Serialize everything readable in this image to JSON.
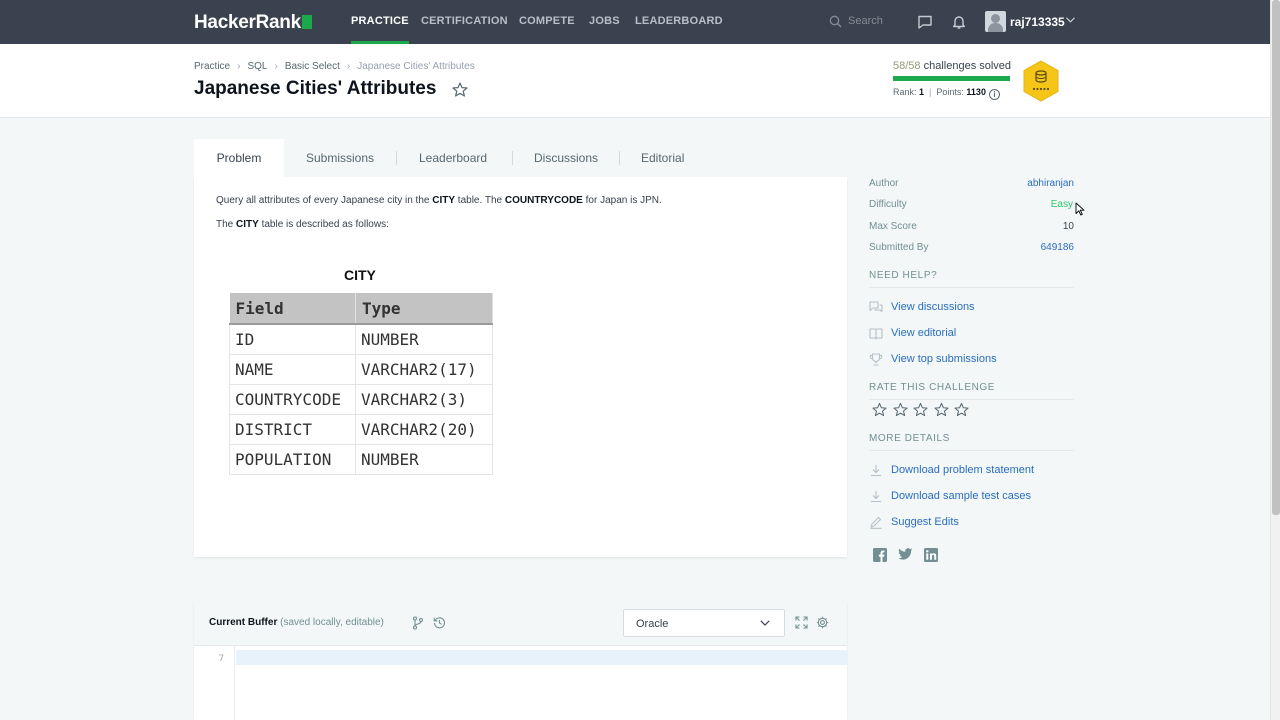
{
  "nav": {
    "logo": "HackerRank",
    "items": [
      "PRACTICE",
      "CERTIFICATION",
      "COMPETE",
      "JOBS",
      "LEADERBOARD"
    ],
    "active": "PRACTICE",
    "search_placeholder": "Search",
    "username": "raj713335"
  },
  "header": {
    "breadcrumbs": [
      "Practice",
      "SQL",
      "Basic Select",
      "Japanese Cities' Attributes"
    ],
    "title": "Japanese Cities' Attributes",
    "solved_count": "58/58",
    "solved_label": "challenges solved",
    "solved_progress": 1.0,
    "rank_label": "Rank:",
    "rank_value": "1",
    "points_label": "Points:",
    "points_value": "1130"
  },
  "tabs": [
    "Problem",
    "Submissions",
    "Leaderboard",
    "Discussions",
    "Editorial"
  ],
  "problem": {
    "p1_a": "Query all attributes of every Japanese city in the ",
    "p1_b": "CITY",
    "p1_c": " table. The ",
    "p1_d": "COUNTRYCODE",
    "p1_e": " for Japan is ",
    "p1_f": "JPN",
    "p1_g": ".",
    "p2_a": "The ",
    "p2_b": "CITY",
    "p2_c": " table is described as follows:",
    "table_caption": "CITY",
    "table_headers": [
      "Field",
      "Type"
    ],
    "table_rows": [
      [
        "ID",
        "NUMBER"
      ],
      [
        "NAME",
        "VARCHAR2(17)"
      ],
      [
        "COUNTRYCODE",
        "VARCHAR2(3)"
      ],
      [
        "DISTRICT",
        "VARCHAR2(20)"
      ],
      [
        "POPULATION",
        "NUMBER"
      ]
    ]
  },
  "sidebar": {
    "author_label": "Author",
    "author_value": "abhiranjan",
    "difficulty_label": "Difficulty",
    "difficulty_value": "Easy",
    "maxscore_label": "Max Score",
    "maxscore_value": "10",
    "submitted_label": "Submitted By",
    "submitted_value": "649186",
    "need_help": "NEED HELP?",
    "view_discussions": "View discussions",
    "view_editorial": "View editorial",
    "view_top": "View top submissions",
    "rate": "RATE THIS CHALLENGE",
    "rating": 0,
    "more": "MORE DETAILS",
    "download_statement": "Download problem statement",
    "download_tests": "Download sample test cases",
    "suggest": "Suggest Edits"
  },
  "editor": {
    "buffer_label": "Current Buffer",
    "buffer_note": "(saved locally, editable)",
    "language": "Oracle",
    "line_number": "7"
  },
  "colors": {
    "nav_bg": "#39424e",
    "accent_green": "#1ba94c",
    "link_blue": "#2a6ec0",
    "badge_gold": "#f5c518"
  }
}
